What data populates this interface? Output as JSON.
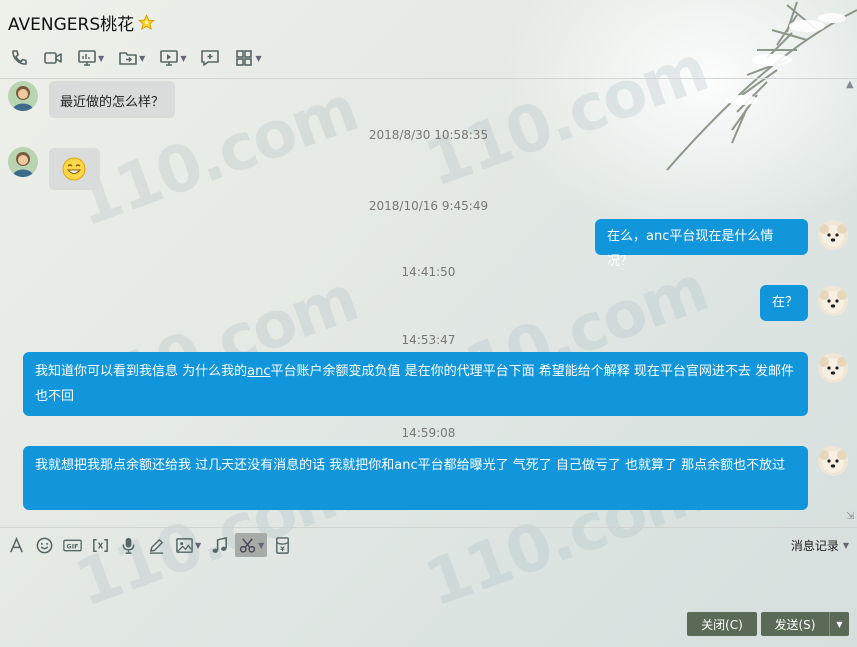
{
  "header": {
    "title": "AVENGERS桃花"
  },
  "messages": {
    "m1": "最近做的怎么样？",
    "ts1": "2018/8/30 10:58:35",
    "ts2": "2018/10/16 9:45:49",
    "m3": "在么，anc平台现在是什么情况？",
    "ts3": "14:41:50",
    "m4": "在？",
    "ts4": "14:53:47",
    "m5_pre": "我知道你可以看到我信息  为什么我的",
    "m5_link": "anc",
    "m5_post": "平台账户余额变成负值  是在你的代理平台下面  希望能给个解释  现在平台官网进不去  发邮件也不回",
    "ts5": "14:59:08",
    "m6": "我就想把我那点余额还给我   过几天还没有消息的话  我就把你和anc平台都给曝光了  气死了  自己做亏了 也就算了  那点余额也不放过"
  },
  "input_area": {
    "history_label": "消息记录",
    "close_label": "关闭(C)",
    "send_label": "发送(S)"
  },
  "colors": {
    "outgoing_bubble": "#1296db",
    "incoming_bubble": "#dadcdb",
    "action_button": "#5b6a57"
  }
}
